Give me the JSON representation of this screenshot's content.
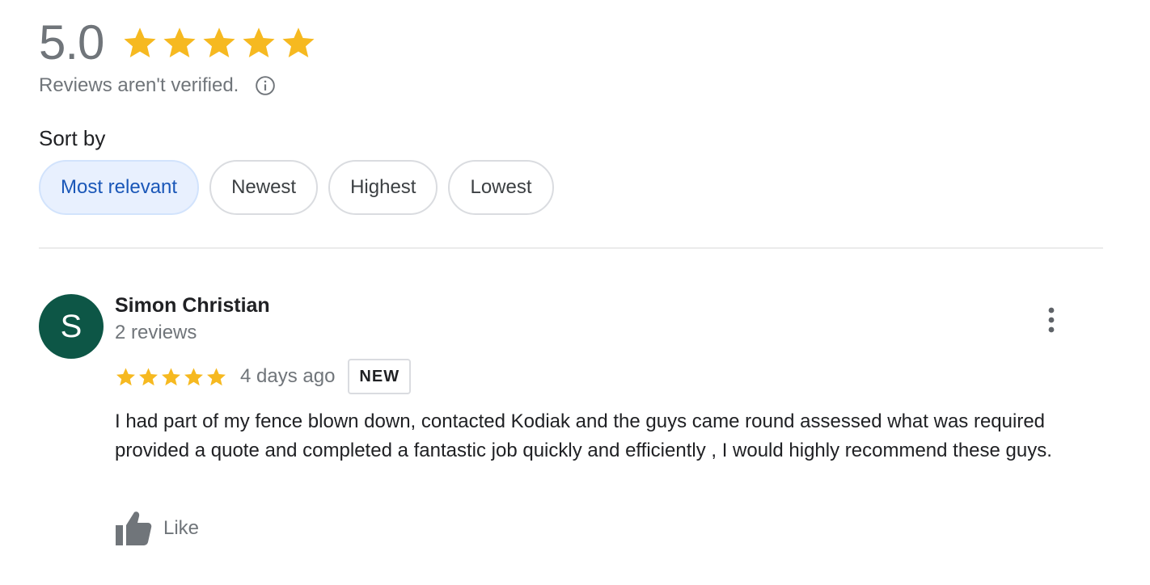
{
  "summary": {
    "rating": "5.0",
    "stars": 5,
    "verified_text": "Reviews aren't verified.",
    "info_icon": "info-icon"
  },
  "sort": {
    "label": "Sort by",
    "options": [
      "Most relevant",
      "Newest",
      "Highest",
      "Lowest"
    ],
    "selected": "Most relevant"
  },
  "review": {
    "avatar_letter": "S",
    "avatar_color": "#0d5646",
    "author": "Simon Christian",
    "author_reviews": "2 reviews",
    "stars": 5,
    "date": "4 days ago",
    "badge": "NEW",
    "text": "I had part of my fence blown down, contacted Kodiak and the guys came round assessed what was required provided a quote and completed a fantastic job quickly and efficiently , I would highly recommend these guys.",
    "like_label": "Like",
    "more_icon": "more-vert-icon",
    "like_icon": "thumbs-up-icon"
  },
  "colors": {
    "star": "#f6b920",
    "selected_chip_bg": "#e8f0fe",
    "selected_chip_text": "#1a57b8",
    "muted_text": "#70757a"
  }
}
